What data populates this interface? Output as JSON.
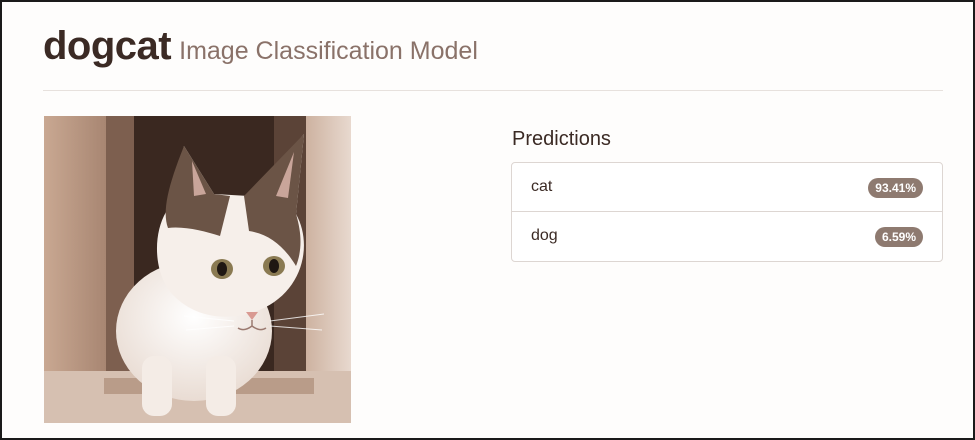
{
  "header": {
    "brand": "dogcat",
    "subtitle": "Image Classification Model"
  },
  "image": {
    "subject": "cat",
    "icon": "cat-photo"
  },
  "predictions": {
    "title": "Predictions",
    "items": [
      {
        "label": "cat",
        "value": "93.41%"
      },
      {
        "label": "dog",
        "value": "6.59%"
      }
    ]
  },
  "colors": {
    "brand_text": "#3b2a24",
    "subtitle_text": "#8a7269",
    "badge_bg": "#8e7a70",
    "border": "#ddd6d2"
  }
}
